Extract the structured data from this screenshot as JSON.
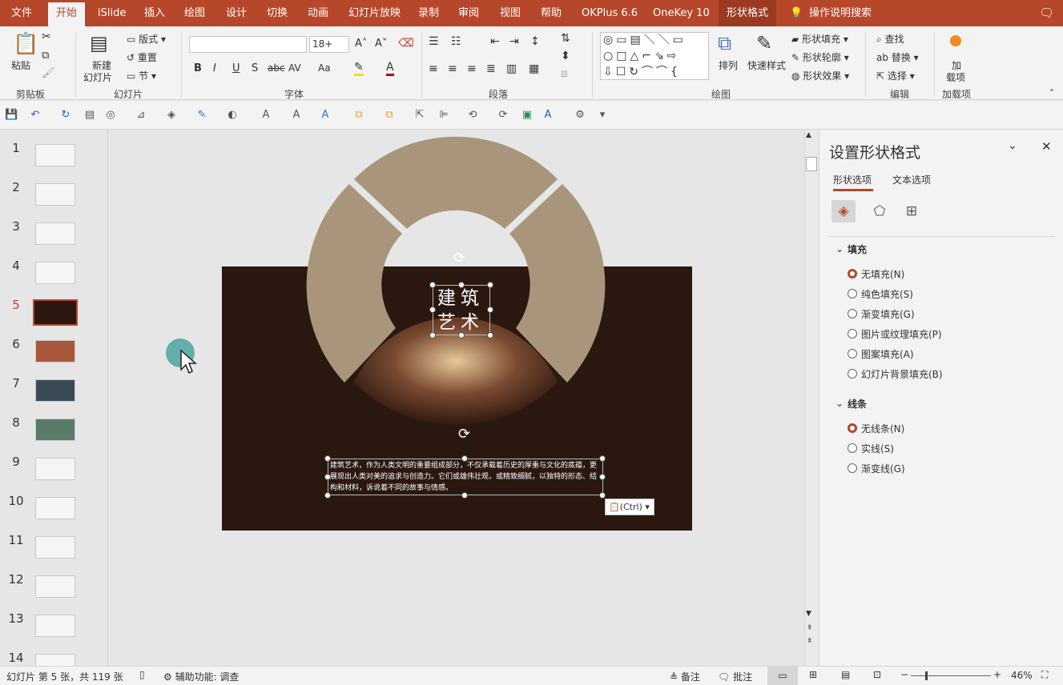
{
  "menu": {
    "tabs": [
      "文件",
      "开始",
      "iSlide",
      "插入",
      "绘图",
      "设计",
      "切换",
      "动画",
      "幻灯片放映",
      "录制",
      "审阅",
      "视图",
      "帮助",
      "OKPlus 6.6",
      "OneKey 10",
      "形状格式"
    ],
    "search": "操作说明搜索"
  },
  "ribbon": {
    "clipboard": {
      "paste": "粘贴",
      "group": "剪贴板"
    },
    "slides": {
      "new_slide": "新建",
      "new_slide2": "幻灯片",
      "layout": "版式",
      "reset": "重置",
      "section": "节",
      "group": "幻灯片"
    },
    "font": {
      "name": "",
      "size": "18+",
      "group": "字体"
    },
    "paragraph": {
      "group": "段落"
    },
    "drawing": {
      "arrange": "排列",
      "quick_styles": "快速样式",
      "shape_fill": "形状填充",
      "shape_outline": "形状轮廓",
      "shape_effects": "形状效果",
      "group": "绘图"
    },
    "editing": {
      "find": "查找",
      "replace": "替换",
      "select": "选择",
      "group": "编辑"
    },
    "addins": {
      "label1": "加",
      "label2": "载项",
      "group": "加载项"
    }
  },
  "thumbnails": [
    "1",
    "2",
    "3",
    "4",
    "5",
    "6",
    "7",
    "8",
    "9",
    "10",
    "11",
    "12",
    "13",
    "14"
  ],
  "slide": {
    "title_line1": "建筑",
    "title_line2": "艺术",
    "body": "建筑艺术，作为人类文明的重要组成部分，不仅承载着历史的厚重与文化的底蕴，更展现出人类对美的追求与创造力。它们或雄伟壮观，或精致细腻，以独特的形态、结构和材料，诉说着不同的故事与情感。",
    "paste_hint": "(Ctrl)"
  },
  "pane": {
    "title": "设置形状格式",
    "tab_shape": "形状选项",
    "tab_text": "文本选项",
    "fill_header": "填充",
    "fill_options": [
      "无填充(N)",
      "纯色填充(S)",
      "渐变填充(G)",
      "图片或纹理填充(P)",
      "图案填充(A)",
      "幻灯片背景填充(B)"
    ],
    "line_header": "线条",
    "line_options": [
      "无线条(N)",
      "实线(S)",
      "渐变线(G)"
    ]
  },
  "status": {
    "slide_info": "幻灯片 第 5 张，共 119 张",
    "accessibility": "辅助功能: 调查",
    "notes": "备注",
    "comments": "批注",
    "zoom": "46%"
  },
  "colors": {
    "accent": "#b7472a",
    "slide_bg": "#2a1810",
    "ring": "#a8957c"
  }
}
